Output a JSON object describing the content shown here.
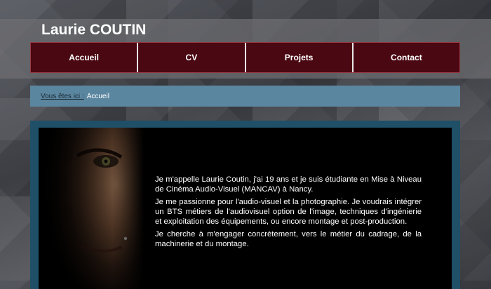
{
  "site": {
    "title": "Laurie COUTIN"
  },
  "nav": {
    "items": [
      {
        "label": "Accueil"
      },
      {
        "label": "CV"
      },
      {
        "label": "Projets"
      },
      {
        "label": "Contact"
      }
    ]
  },
  "breadcrumb": {
    "prefix": "Vous êtes ici :",
    "current": "Accueil"
  },
  "content": {
    "paragraphs": [
      "Je m'appelle Laurie Coutin, j'ai 19 ans et je suis étudiante en Mise à Niveau de Cinéma Audio-Visuel (MANCAV) à Nancy.",
      "Je me passionne pour l'audio-visuel et la photographie. Je voudrais intégrer un BTS métiers de l'audiovisuel option de l'image, techniques d'ingénierie et exploitation des équipements, ou encore montage et post-production.",
      "Je cherche à m'engager concrètement, vers le métier du cadrage, de la machinerie et du montage."
    ]
  },
  "colors": {
    "nav_bg": "#4a0812",
    "breadcrumb_bg": "#5b86a0",
    "content_frame": "#1f5068"
  }
}
